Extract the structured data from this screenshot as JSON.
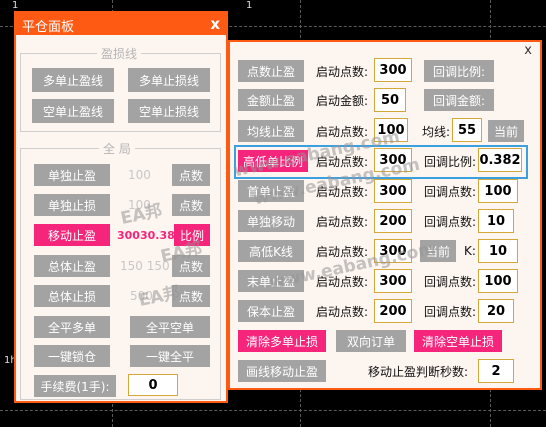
{
  "chart_bg": {
    "axis_labels": [
      "1",
      "1"
    ],
    "indicator_label": "1h"
  },
  "left_panel": {
    "title": "平仓面板",
    "close": "x",
    "group1_legend": "盈损线",
    "group2_legend": "全 局",
    "btn_multi_tp": "多单止盈线",
    "btn_multi_sl": "多单止损线",
    "btn_short_tp": "空单止盈线",
    "btn_short_sl": "空单止损线",
    "btn_single_tp": "单独止盈",
    "single_tp_value": "100",
    "single_tp_unit": "点数",
    "btn_single_sl": "单独止损",
    "single_sl_value": "100",
    "single_sl_unit": "点数",
    "btn_trailing": "移动止盈",
    "trailing_values": "30030.382",
    "trailing_unit": "比例",
    "btn_total_tp": "总体止盈",
    "total_tp_value": "150 150",
    "total_tp_unit": "点数",
    "btn_total_sl": "总体止损",
    "total_sl_value": "500",
    "total_sl_unit": "点数",
    "btn_close_long": "全平多单",
    "btn_close_short": "全平空单",
    "btn_lock": "一键锁仓",
    "btn_close_all": "一键全平",
    "fee_label": "手续费(1手):",
    "fee_value": "0"
  },
  "right_panel": {
    "close": "x",
    "rows": {
      "r1": {
        "btn": "点数止盈",
        "label": "启动点数:",
        "value": "300",
        "btn2": "回调比例:"
      },
      "r2": {
        "btn": "金额止盈",
        "label": "启动金额:",
        "value": "50",
        "btn2": "回调金额:"
      },
      "r3": {
        "btn": "均线止盈",
        "label": "启动点数:",
        "value": "100",
        "label2": "均线:",
        "value2": "55",
        "btn2": "当前"
      },
      "r4": {
        "btn": "高低单比例",
        "label": "启动点数:",
        "value": "300",
        "label2": "回调比例:",
        "value2": "0.382"
      },
      "r5": {
        "btn": "首单止盈",
        "label": "启动点数:",
        "value": "300",
        "label2": "回调点数:",
        "value2": "100"
      },
      "r6": {
        "btn": "单独移动",
        "label": "启动点数:",
        "value": "200",
        "label2": "回调点数:",
        "value2": "10"
      },
      "r7": {
        "btn": "高低K线",
        "label": "启动点数:",
        "value": "300",
        "btn2": "当前",
        "label2": "K:",
        "value2": "10"
      },
      "r8": {
        "btn": "末单止盈",
        "label": "启动点数:",
        "value": "300",
        "label2": "回调点数:",
        "value2": "100"
      },
      "r9": {
        "btn": "保本止盈",
        "label": "启动点数:",
        "value": "200",
        "label2": "回调点数:",
        "value2": "20"
      }
    },
    "btn_clear_long": "清除多单止损",
    "btn_two_way": "双向订单",
    "btn_clear_short": "清除空单止损",
    "btn_draw_trailing": "画线移动止盈",
    "trailing_seconds_label": "移动止盈判断秒数:",
    "trailing_seconds_value": "2"
  },
  "watermarks": [
    "EA邦",
    "www.eabang.com",
    "EA邦",
    "www.eabang.com",
    "EA邦",
    "www.eabang.com"
  ],
  "colors": {
    "accent_orange": "#ff5a14",
    "pink": "#f4257a",
    "highlight_blue": "#3aa0e0"
  }
}
